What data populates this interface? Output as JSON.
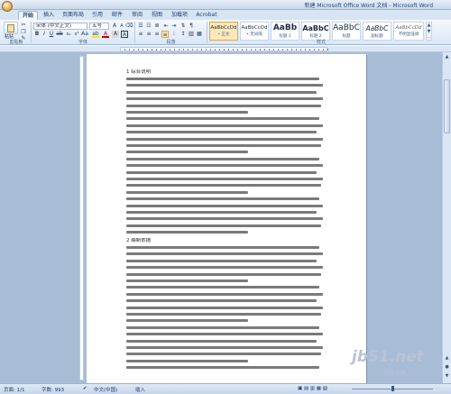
{
  "window": {
    "title": "新建 Microsoft Office Word 文档 - Microsoft Word"
  },
  "tabs": [
    {
      "label": "开始",
      "active": true
    },
    {
      "label": "插入"
    },
    {
      "label": "页面布局"
    },
    {
      "label": "引用"
    },
    {
      "label": "邮件"
    },
    {
      "label": "审阅"
    },
    {
      "label": "视图"
    },
    {
      "label": "加载项"
    },
    {
      "label": "Acrobat"
    }
  ],
  "ribbon": {
    "clipboard": {
      "paste_label": "粘贴",
      "group_label": "剪贴板"
    },
    "font": {
      "font_name": "宋体 (中文正文)",
      "font_size": "五号",
      "group_label": "字体"
    },
    "paragraph": {
      "group_label": "段落"
    },
    "styles": {
      "group_label": "样式",
      "items": [
        {
          "sample": "AaBbCcDd",
          "name": "• 正文",
          "selected": true
        },
        {
          "sample": "AaBbCcDd",
          "name": "• 无间隔"
        },
        {
          "sample": "AaBb",
          "name": "标题 1"
        },
        {
          "sample": "AaBbC",
          "name": "标题 2"
        },
        {
          "sample": "AaBbC",
          "name": "标题"
        },
        {
          "sample": "AaBbC",
          "name": "副标题"
        },
        {
          "sample": "AaBbCcDd",
          "name": "不明显强调"
        }
      ]
    }
  },
  "document": {
    "heading_1": "1 综合说明",
    "heading_2": "2 编制依据",
    "line_fill_pattern": [
      0.98,
      1.0,
      0.97,
      1.0,
      0.99,
      0.62
    ]
  },
  "status": {
    "page": "页面: 1/1",
    "words": "字数: 993",
    "language": "中文(中国)",
    "mode": "插入"
  },
  "watermark": {
    "main": "jb51.net",
    "sub": "脚本之家"
  }
}
